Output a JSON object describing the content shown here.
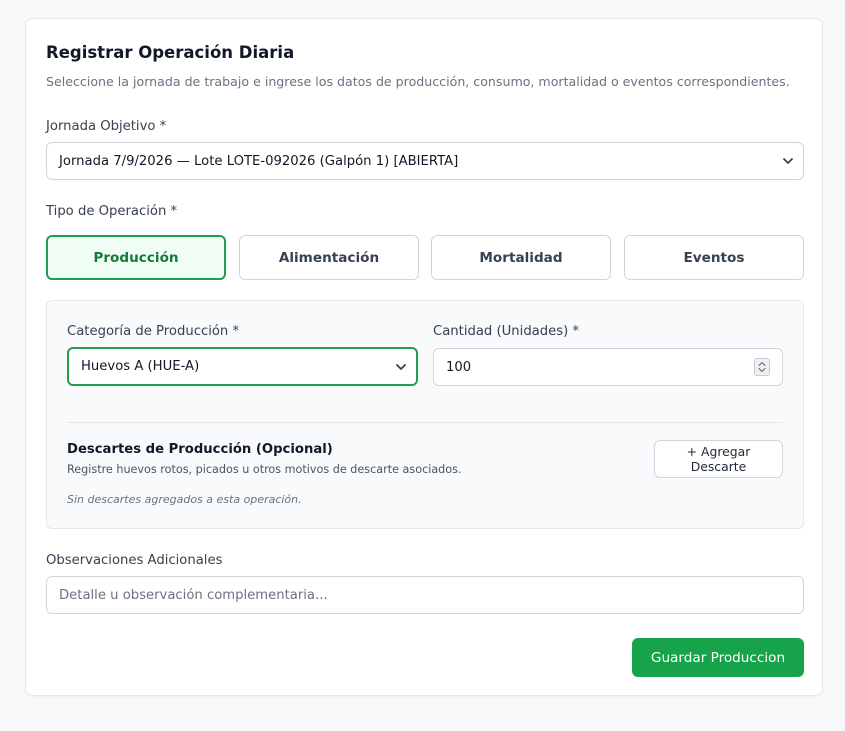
{
  "form": {
    "title": "Registrar Operación Diaria",
    "subtitle": "Seleccione la jornada de trabajo e ingrese los datos de producción, consumo, mortalidad o eventos correspondientes.",
    "jornada_label": "Jornada Objetivo *",
    "jornada_value": "Jornada 7/9/2026 — Lote LOTE-092026 (Galpón 1) [ABIERTA]",
    "tipo_label": "Tipo de Operación *",
    "tabs": [
      {
        "label": "Producción",
        "active": true
      },
      {
        "label": "Alimentación",
        "active": false
      },
      {
        "label": "Mortalidad",
        "active": false
      },
      {
        "label": "Eventos",
        "active": false
      }
    ],
    "categoria_label": "Categoría de Producción *",
    "categoria_value": "Huevos A (HUE-A)",
    "cantidad_label": "Cantidad (Unidades) *",
    "cantidad_value": "100",
    "descartes_title": "Descartes de Producción (Opcional)",
    "descartes_subtitle": "Registre huevos rotos, picados u otros motivos de descarte asociados.",
    "descartes_empty": "Sin descartes agregados a esta operación.",
    "add_descarte_label": "+ Agregar Descarte",
    "observaciones_label": "Observaciones Adicionales",
    "observaciones_placeholder": "Detalle u observación complementaria...",
    "save_label": "Guardar Produccion"
  },
  "icons": {
    "select_chevron": "chevron-down-icon",
    "spinner": "spinner-arrows-icon"
  },
  "colors": {
    "accent": "#16a34a",
    "accent_border": "#22a04b",
    "active_tab_bg": "#f0fdf4",
    "active_tab_text": "#167a37"
  }
}
